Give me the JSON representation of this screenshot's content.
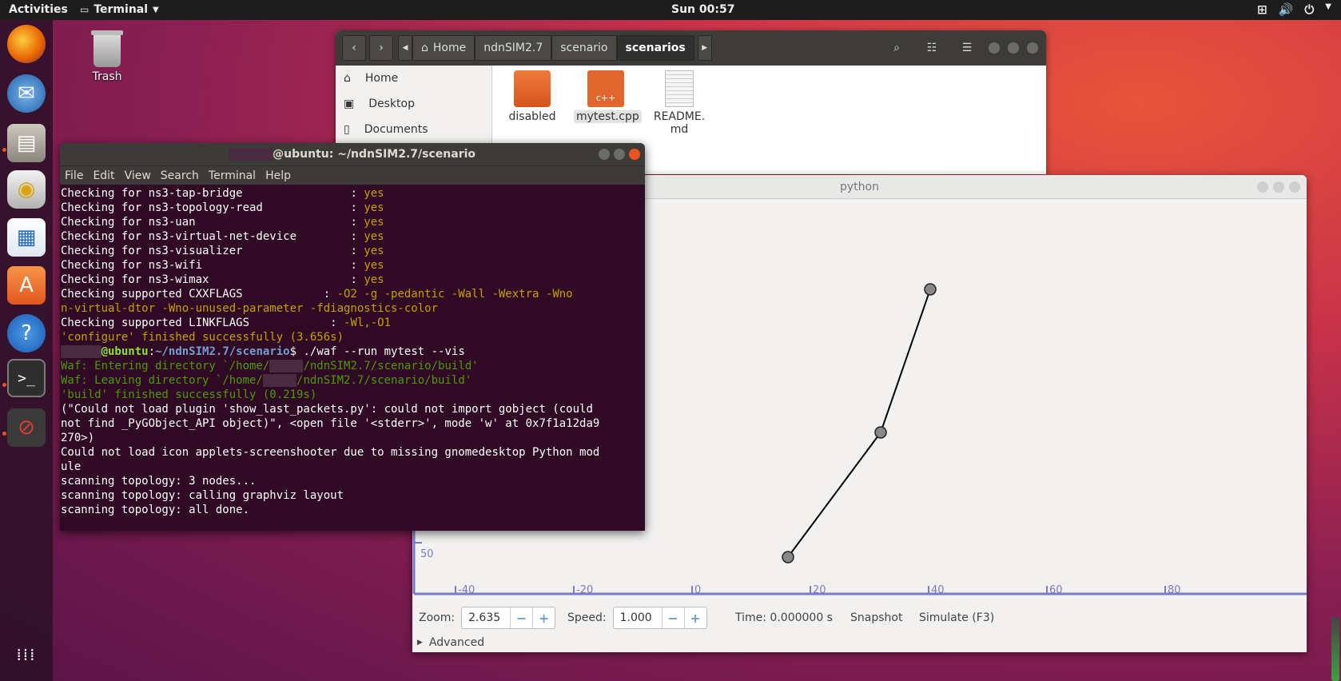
{
  "topbar": {
    "activities": "Activities",
    "app_name": "Terminal",
    "clock": "Sun 00:57",
    "tray_icons": [
      "network-icon",
      "volume-icon",
      "power-icon"
    ]
  },
  "desktop": {
    "trash_label": "Trash"
  },
  "dock": {
    "items": [
      "firefox-icon",
      "thunderbird-icon",
      "files-icon",
      "rhythmbox-icon",
      "writer-icon",
      "software-icon",
      "help-icon",
      "terminal-icon",
      "blocked-app-icon",
      "show-apps-icon"
    ]
  },
  "files": {
    "breadcrumbs": [
      "Home",
      "ndnSIM2.7",
      "scenario",
      "scenarios"
    ],
    "sidebar": [
      "Home",
      "Desktop",
      "Documents"
    ],
    "items": [
      {
        "name": "disabled",
        "type": "folder"
      },
      {
        "name": "mytest.cpp",
        "type": "cpp"
      },
      {
        "name": "README.\nmd",
        "type": "text"
      }
    ]
  },
  "terminal": {
    "title": "@ubuntu: ~/ndnSIM2.7/scenario",
    "menu": [
      "File",
      "Edit",
      "View",
      "Search",
      "Terminal",
      "Help"
    ],
    "checks": [
      {
        "label": "Checking for ns3-tap-bridge",
        "value": "yes"
      },
      {
        "label": "Checking for ns3-topology-read",
        "value": "yes"
      },
      {
        "label": "Checking for ns3-uan",
        "value": "yes"
      },
      {
        "label": "Checking for ns3-virtual-net-device",
        "value": "yes"
      },
      {
        "label": "Checking for ns3-visualizer",
        "value": "yes"
      },
      {
        "label": "Checking for ns3-wifi",
        "value": "yes"
      },
      {
        "label": "Checking for ns3-wimax",
        "value": "yes"
      }
    ],
    "cxx_label": "Checking supported CXXFLAGS",
    "cxx_value1": "-O2 -g -pedantic -Wall -Wextra -Wno",
    "cxx_value2": "n-virtual-dtor -Wno-unused-parameter -fdiagnostics-color",
    "link_label": "Checking supported LINKFLAGS",
    "link_value": "-Wl,-O1",
    "configure_done": "'configure' finished successfully (3.656s)",
    "prompt_host": "@ubuntu",
    "prompt_path": "~/ndnSIM2.7/scenario",
    "command": "$ ./waf --run mytest --vis",
    "waf_enter_a": "Waf: Entering directory `/home/",
    "waf_enter_b": "/ndnSIM2.7/scenario/build'",
    "waf_leave_a": "Waf: Leaving directory `/home/",
    "waf_leave_b": "/ndnSIM2.7/scenario/build'",
    "build_done": "'build' finished successfully (0.219s)",
    "out1": "(\"Could not load plugin 'show_last_packets.py': could not import gobject (could",
    "out2": "not find _PyGObject_API object)\", <open file '<stderr>', mode 'w' at 0x7f1a12da9",
    "out3": "270>)",
    "out4": "Could not load icon applets-screenshooter due to missing gnomedesktop Python mod",
    "out5": "ule",
    "out6": "scanning topology: 3 nodes...",
    "out7": "scanning topology: calling graphviz layout",
    "out8": "scanning topology: all done."
  },
  "python": {
    "title": "python",
    "axis_tick_y": "50",
    "axis_ticks_x": [
      "-40",
      "-20",
      "0",
      "20",
      "40",
      "60",
      "80"
    ],
    "zoom_label": "Zoom:",
    "zoom_value": "2.635",
    "speed_label": "Speed:",
    "speed_value": "1.000",
    "time_label": "Time: 0.000000 s",
    "snapshot_label": "Snapshot",
    "simulate_label": "Simulate (F3)",
    "advanced_label": "Advanced",
    "nodes_count": 3
  }
}
